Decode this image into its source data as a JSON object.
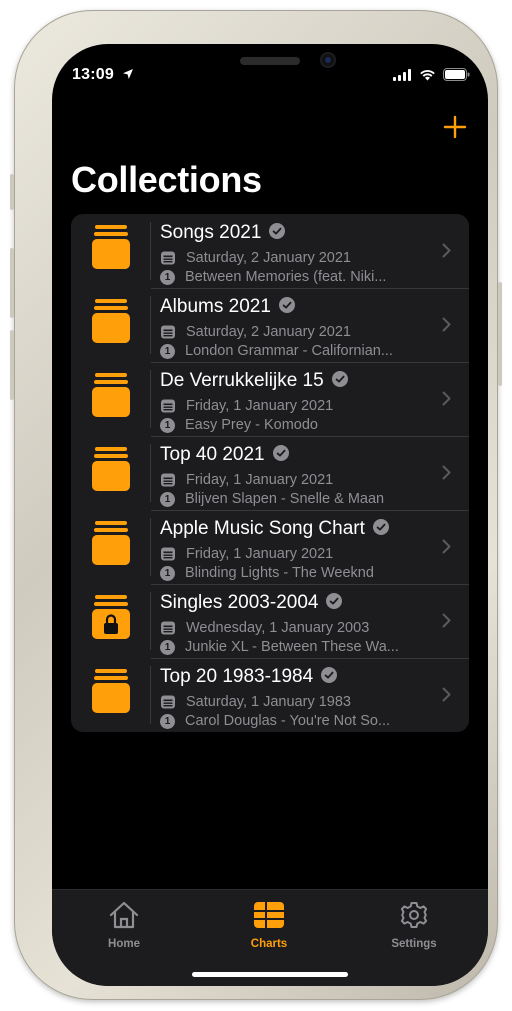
{
  "status": {
    "time": "13:09"
  },
  "page": {
    "title": "Collections"
  },
  "colors": {
    "accent": "#FF9F0A",
    "background": "#000000",
    "cell": "#1C1C1E",
    "secondary_text": "#8E8E93"
  },
  "collections": [
    {
      "name": "Songs 2021",
      "date": "Saturday, 2 January 2021",
      "rank": "1",
      "top_track": "Between Memories (feat. Niki...",
      "locked": false
    },
    {
      "name": "Albums 2021",
      "date": "Saturday, 2 January 2021",
      "rank": "1",
      "top_track": "London Grammar - Californian...",
      "locked": false
    },
    {
      "name": "De Verrukkelijke 15",
      "date": "Friday, 1 January 2021",
      "rank": "1",
      "top_track": "Easy Prey - Komodo",
      "locked": false
    },
    {
      "name": "Top 40 2021",
      "date": "Friday, 1 January 2021",
      "rank": "1",
      "top_track": "Blijven Slapen - Snelle & Maan",
      "locked": false
    },
    {
      "name": "Apple Music Song Chart",
      "date": "Friday, 1 January 2021",
      "rank": "1",
      "top_track": "Blinding Lights - The Weeknd",
      "locked": false
    },
    {
      "name": "Singles 2003-2004",
      "date": "Wednesday, 1 January 2003",
      "rank": "1",
      "top_track": "Junkie XL - Between These Wa...",
      "locked": true
    },
    {
      "name": "Top 20 1983-1984",
      "date": "Saturday, 1 January 1983",
      "rank": "1",
      "top_track": "Carol Douglas - You're Not So...",
      "locked": false
    }
  ],
  "tabbar": {
    "home_label": "Home",
    "charts_label": "Charts",
    "settings_label": "Settings",
    "active": "Charts",
    "inactive_color": "#8E8E93"
  },
  "icons": {
    "add": "plus-icon",
    "collection": "stack-folder-icon",
    "locked_collection": "locked-stack-folder-icon",
    "verified": "checkmark-seal-icon",
    "date": "calendar-icon",
    "rank": "number-one-badge",
    "chevron": "chevron-right-icon",
    "home": "house-icon",
    "charts": "grid-table-icon",
    "settings": "gear-icon"
  }
}
